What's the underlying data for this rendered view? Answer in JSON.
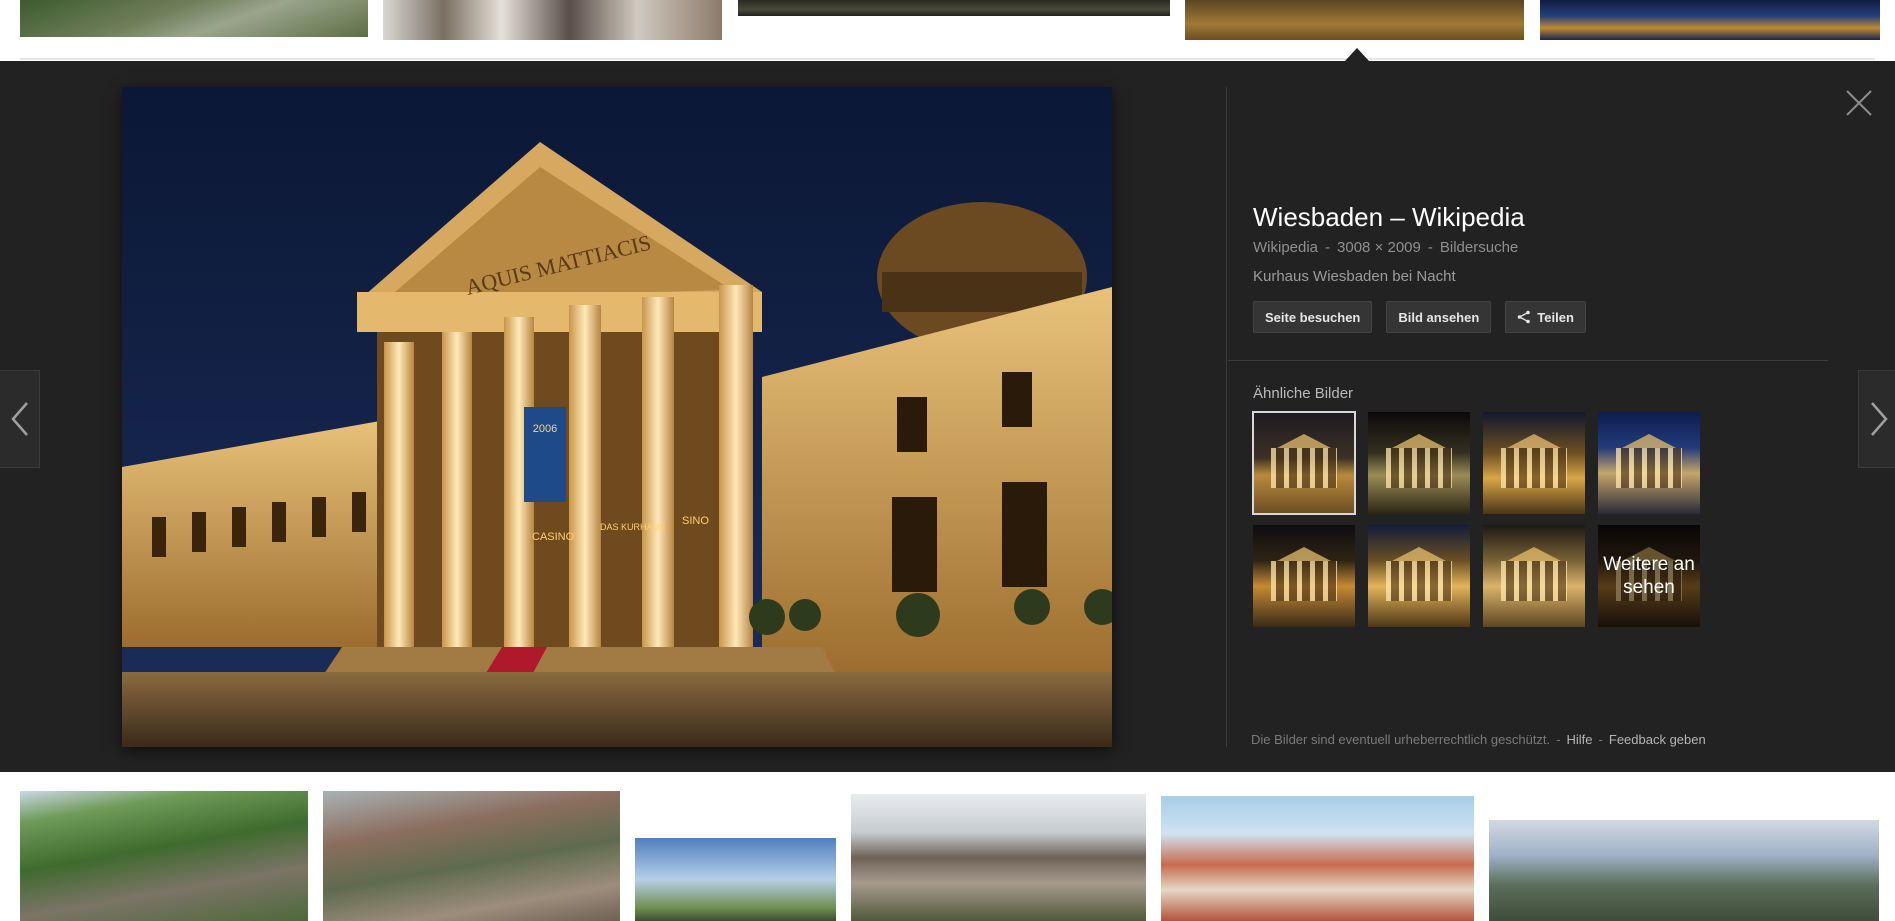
{
  "result": {
    "title": "Wiesbaden – Wikipedia",
    "source": "Wikipedia",
    "dimensions": "3008 × 2009",
    "search_link": "Bildersuche",
    "separator": "-",
    "description": "Kurhaus Wiesbaden bei Nacht"
  },
  "image_text": {
    "inscription": "AQUIS MATTIACIS",
    "banner_year": "2006",
    "sign_casino": "CASINO",
    "sign_kurhaus": "DAS KURHAUS",
    "sign_casino_right": "SINO"
  },
  "actions": {
    "visit": "Seite besuchen",
    "view": "Bild ansehen",
    "share": "Teilen"
  },
  "similar": {
    "heading": "Ähnliche Bilder",
    "more_label": "Weitere ansehen"
  },
  "navigation": {
    "prev_icon": "chevron-left-icon",
    "next_icon": "chevron-right-icon",
    "close_icon": "close-icon"
  },
  "footer": {
    "notice": "Die Bilder sind eventuell urheberrechtlich geschützt.",
    "separator": "-",
    "help": "Hilfe",
    "feedback": "Feedback geben"
  },
  "colors": {
    "panel_background": "#222222",
    "title_text": "#ffffff",
    "meta_text": "#8f8f8f"
  }
}
